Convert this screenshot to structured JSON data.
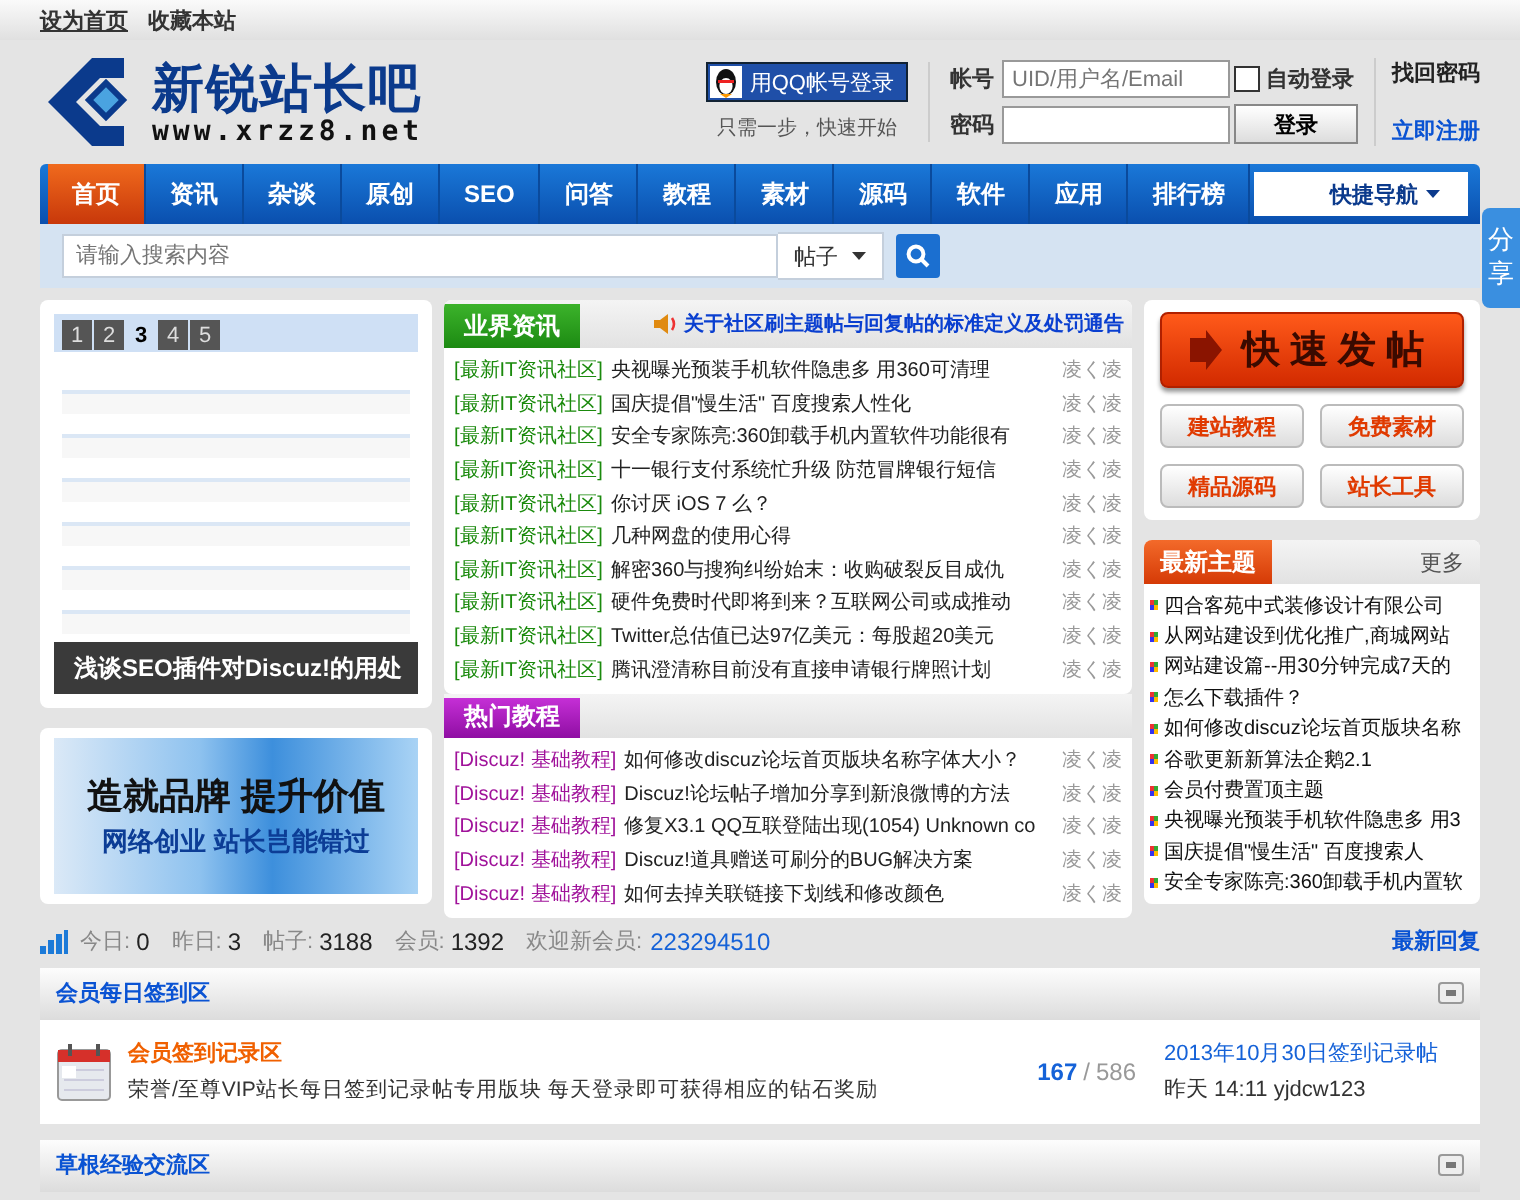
{
  "top_links": [
    "设为首页",
    "收藏本站"
  ],
  "logo": {
    "name": "新锐站长吧",
    "url": "www.xrzz8.net"
  },
  "qq_login": {
    "button": "用QQ帐号登录",
    "hint": "只需一步，快速开始"
  },
  "login": {
    "username_label": "帐号",
    "username_placeholder": "UID/用户名/Email",
    "password_label": "密码",
    "remember": {
      "label": "自动登录",
      "checked": false
    },
    "submit": "登录",
    "forgot": "找回密码",
    "register": "立即注册"
  },
  "nav": {
    "items": [
      {
        "label": "首页",
        "selected": true
      },
      {
        "label": "资讯",
        "selected": false
      },
      {
        "label": "杂谈",
        "selected": false
      },
      {
        "label": "原创",
        "selected": false
      },
      {
        "label": "SEO",
        "selected": false
      },
      {
        "label": "问答",
        "selected": false
      },
      {
        "label": "教程",
        "selected": false
      },
      {
        "label": "素材",
        "selected": false
      },
      {
        "label": "源码",
        "selected": false
      },
      {
        "label": "软件",
        "selected": false
      },
      {
        "label": "应用",
        "selected": false
      },
      {
        "label": "排行榜",
        "selected": false
      }
    ],
    "quick_nav": "快捷导航"
  },
  "search": {
    "placeholder": "请输入搜索内容",
    "scope": "帖子"
  },
  "share_tab": "分享",
  "slider": {
    "pages": [
      {
        "label": "1",
        "selected": false
      },
      {
        "label": "2",
        "selected": false
      },
      {
        "label": "3",
        "selected": true
      },
      {
        "label": "4",
        "selected": false
      },
      {
        "label": "5",
        "selected": false
      }
    ],
    "caption": "浅谈SEO插件对Discuz!的用处"
  },
  "banner": {
    "headline": "造就品牌 提升价值",
    "subline": "网络创业 站长岂能错过"
  },
  "news": {
    "title": "业界资讯",
    "notice": "关于社区刷主题帖与回复帖的标准定义及处罚通告",
    "items": [
      {
        "tag": "[最新IT资讯社区]",
        "title": "央视曝光预装手机软件隐患多 用360可清理",
        "time": "凌く凌"
      },
      {
        "tag": "[最新IT资讯社区]",
        "title": "国庆提倡\"慢生活\" 百度搜索人性化",
        "time": "凌く凌"
      },
      {
        "tag": "[最新IT资讯社区]",
        "title": "安全专家陈亮:360卸载手机内置软件功能很有",
        "time": "凌く凌"
      },
      {
        "tag": "[最新IT资讯社区]",
        "title": "十一银行支付系统忙升级 防范冒牌银行短信",
        "time": "凌く凌"
      },
      {
        "tag": "[最新IT资讯社区]",
        "title": "你讨厌 iOS 7 么？",
        "time": "凌く凌"
      },
      {
        "tag": "[最新IT资讯社区]",
        "title": "几种网盘的使用心得",
        "time": "凌く凌"
      },
      {
        "tag": "[最新IT资讯社区]",
        "title": "解密360与搜狗纠纷始末：收购破裂反目成仇",
        "time": "凌く凌"
      },
      {
        "tag": "[最新IT资讯社区]",
        "title": "硬件免费时代即将到来？互联网公司或成推动",
        "time": "凌く凌"
      },
      {
        "tag": "[最新IT资讯社区]",
        "title": "Twitter总估值已达97亿美元：每股超20美元",
        "time": "凌く凌"
      },
      {
        "tag": "[最新IT资讯社区]",
        "title": "腾讯澄清称目前没有直接申请银行牌照计划",
        "time": "凌く凌"
      }
    ]
  },
  "tutorials": {
    "title": "热门教程",
    "items": [
      {
        "tag": "[Discuz! 基础教程]",
        "title": "如何修改discuz论坛首页版块名称字体大小？",
        "time": "凌く凌"
      },
      {
        "tag": "[Discuz! 基础教程]",
        "title": "Discuz!论坛帖子增加分享到新浪微博的方法",
        "time": "凌く凌"
      },
      {
        "tag": "[Discuz! 基础教程]",
        "title": "修复X3.1 QQ互联登陆出现(1054) Unknown co",
        "time": "凌く凌"
      },
      {
        "tag": "[Discuz! 基础教程]",
        "title": "Discuz!道具赠送可刷分的BUG解决方案",
        "time": "凌く凌"
      },
      {
        "tag": "[Discuz! 基础教程]",
        "title": "如何去掉关联链接下划线和修改颜色",
        "time": "凌く凌"
      }
    ]
  },
  "quick_post": {
    "button": "快速发帖",
    "links": [
      "建站教程",
      "免费素材",
      "精品源码",
      "站长工具"
    ]
  },
  "latest": {
    "title": "最新主题",
    "more": "更多",
    "items": [
      "四合客苑中式装修设计有限公司",
      "从网站建设到优化推广,商城网站",
      "网站建设篇--用30分钟完成7天的",
      "怎么下载插件？",
      "如何修改discuz论坛首页版块名称",
      "谷歌更新新算法企鹅2.1",
      "会员付费置顶主题",
      "央视曝光预装手机软件隐患多 用3",
      "国庆提倡\"慢生活\" 百度搜索人",
      "安全专家陈亮:360卸载手机内置软"
    ]
  },
  "stats": {
    "items": [
      {
        "label": "今日:",
        "value": "0"
      },
      {
        "label": "昨日:",
        "value": "3"
      },
      {
        "label": "帖子:",
        "value": "3188"
      },
      {
        "label": "会员:",
        "value": "1392"
      }
    ],
    "welcome_label": "欢迎新会员:",
    "new_member": "223294510",
    "latest_replies": "最新回复"
  },
  "forums": [
    {
      "title": "会员每日签到区",
      "boards": [
        {
          "name": "会员签到记录区",
          "description": "荣誉/至尊VIP站长每日签到记录帖专用版块 每天登录即可获得相应的钻石奖励",
          "topics": "167",
          "separator": "/",
          "posts": "586",
          "last_post": "2013年10月30日签到记录帖",
          "last_meta": "昨天 14:11 yjdcw123"
        }
      ]
    },
    {
      "title": "草根经验交流区"
    }
  ]
}
